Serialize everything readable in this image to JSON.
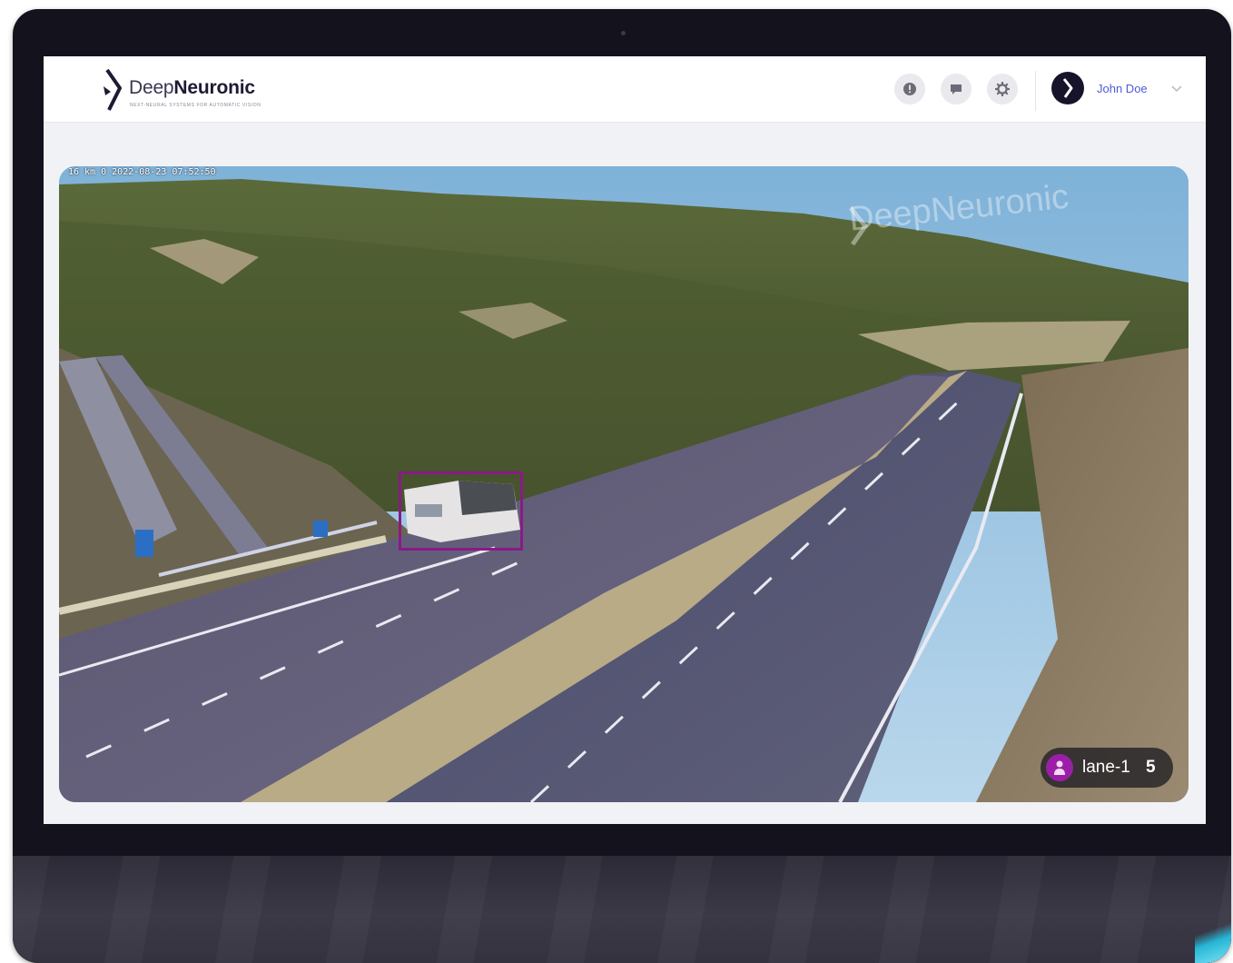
{
  "header": {
    "brand_light": "Deep",
    "brand_bold": "Neuronic",
    "brand_tagline": "NEXT-NEURAL SYSTEMS FOR AUTOMATIC VISION",
    "icons": [
      "alert-icon",
      "chat-icon",
      "settings-icon"
    ],
    "user_name": "John Doe",
    "accent_color": "#4d5bd6"
  },
  "video": {
    "timestamp": "16 km 0  2022-08-23 07:52:50",
    "watermark": "DeepNeuronic",
    "detection_color": "#8a1a86",
    "lane_badge": {
      "label": "lane-1",
      "count": "5",
      "color": "#9b1fa6"
    }
  }
}
